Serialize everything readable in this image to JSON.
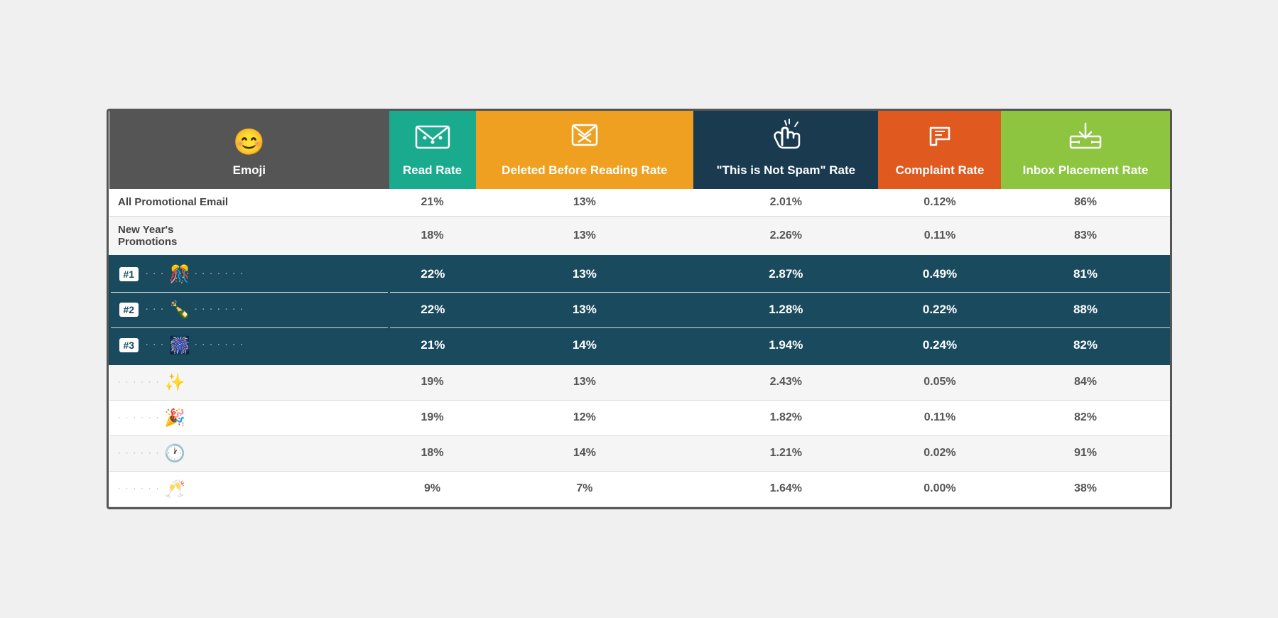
{
  "headers": {
    "emoji": {
      "label": "Emoji",
      "icon": "😊",
      "bg": "#555"
    },
    "read_rate": {
      "label": "Read Rate",
      "icon": "✉️",
      "bg": "#1aaa8e"
    },
    "deleted_rate": {
      "label": "Deleted Before Reading Rate",
      "icon": "📧",
      "bg": "#f0a020"
    },
    "notspam_rate": {
      "label": "\"This is Not Spam\" Rate",
      "icon": "👆",
      "bg": "#1a3a50"
    },
    "complaint_rate": {
      "label": "Complaint Rate",
      "icon": "👎",
      "bg": "#e05a20"
    },
    "inbox_placement": {
      "label": "Inbox Placement Rate",
      "icon": "📥",
      "bg": "#8dc440"
    }
  },
  "rows": [
    {
      "type": "summary",
      "label": "All Promotional Email",
      "emoji": "",
      "read_rate": "21%",
      "deleted_rate": "13%",
      "notspam_rate": "2.01%",
      "complaint_rate": "0.12%",
      "inbox_placement": "86%"
    },
    {
      "type": "summary",
      "label": "New Year's\nPromotions",
      "emoji": "",
      "read_rate": "18%",
      "deleted_rate": "13%",
      "notspam_rate": "2.26%",
      "complaint_rate": "0.11%",
      "inbox_placement": "83%"
    },
    {
      "type": "highlight",
      "rank": "#1",
      "emoji": "🎊",
      "read_rate": "22%",
      "deleted_rate": "13%",
      "notspam_rate": "2.87%",
      "complaint_rate": "0.49%",
      "inbox_placement": "81%"
    },
    {
      "type": "highlight",
      "rank": "#2",
      "emoji": "🍾",
      "read_rate": "22%",
      "deleted_rate": "13%",
      "notspam_rate": "1.28%",
      "complaint_rate": "0.22%",
      "inbox_placement": "88%"
    },
    {
      "type": "highlight",
      "rank": "#3",
      "emoji": "🎆",
      "read_rate": "21%",
      "deleted_rate": "14%",
      "notspam_rate": "1.94%",
      "complaint_rate": "0.24%",
      "inbox_placement": "82%"
    },
    {
      "type": "normal",
      "emoji": "✨",
      "read_rate": "19%",
      "deleted_rate": "13%",
      "notspam_rate": "2.43%",
      "complaint_rate": "0.05%",
      "inbox_placement": "84%"
    },
    {
      "type": "normal",
      "emoji": "🎉",
      "read_rate": "19%",
      "deleted_rate": "12%",
      "notspam_rate": "1.82%",
      "complaint_rate": "0.11%",
      "inbox_placement": "82%"
    },
    {
      "type": "normal",
      "emoji": "🕐",
      "read_rate": "18%",
      "deleted_rate": "14%",
      "notspam_rate": "1.21%",
      "complaint_rate": "0.02%",
      "inbox_placement": "91%"
    },
    {
      "type": "normal",
      "emoji": "🥂",
      "read_rate": "9%",
      "deleted_rate": "7%",
      "notspam_rate": "1.64%",
      "complaint_rate": "0.00%",
      "inbox_placement": "38%"
    }
  ]
}
